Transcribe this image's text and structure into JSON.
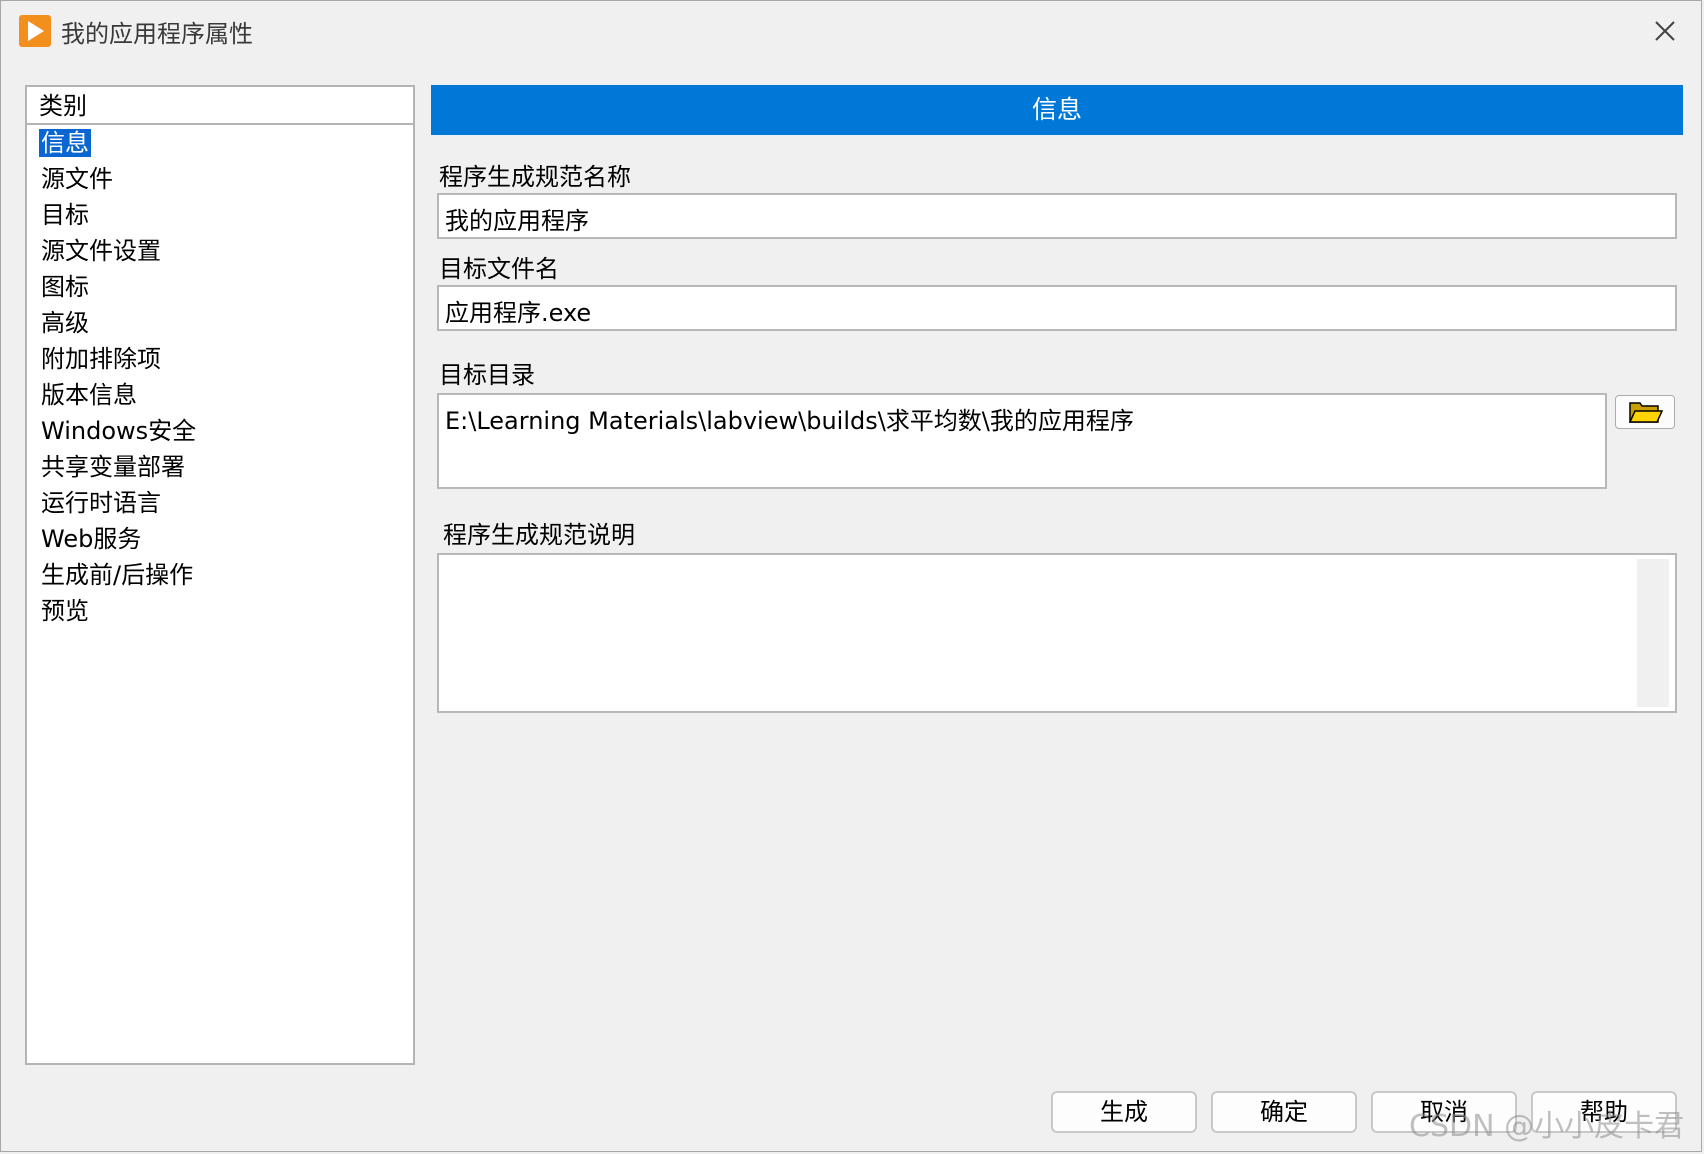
{
  "window": {
    "title": "我的应用程序属性",
    "accent_color": "#0078d7",
    "app_icon": "labview-play-icon",
    "close_icon": "close-icon"
  },
  "category": {
    "header": "类别",
    "items": [
      {
        "label": "信息",
        "selected": true
      },
      {
        "label": "源文件"
      },
      {
        "label": "目标"
      },
      {
        "label": "源文件设置"
      },
      {
        "label": "图标"
      },
      {
        "label": "高级"
      },
      {
        "label": "附加排除项"
      },
      {
        "label": "版本信息"
      },
      {
        "label": "Windows安全"
      },
      {
        "label": "共享变量部署"
      },
      {
        "label": "运行时语言"
      },
      {
        "label": "Web服务"
      },
      {
        "label": "生成前/后操作"
      },
      {
        "label": "预览"
      }
    ]
  },
  "info": {
    "header": "信息",
    "build_spec_name_label": "程序生成规范名称",
    "build_spec_name_value": "我的应用程序",
    "target_filename_label": "目标文件名",
    "target_filename_value": "应用程序.exe",
    "target_dir_label": "目标目录",
    "target_dir_value": "E:\\Learning Materials\\labview\\builds\\求平均数\\我的应用程序",
    "browse_icon": "folder-open-icon",
    "description_label": "程序生成规范说明",
    "description_value": ""
  },
  "buttons": {
    "build": "生成",
    "ok": "确定",
    "cancel": "取消",
    "help": "帮助"
  },
  "watermark": "CSDN @小小皮卡君"
}
